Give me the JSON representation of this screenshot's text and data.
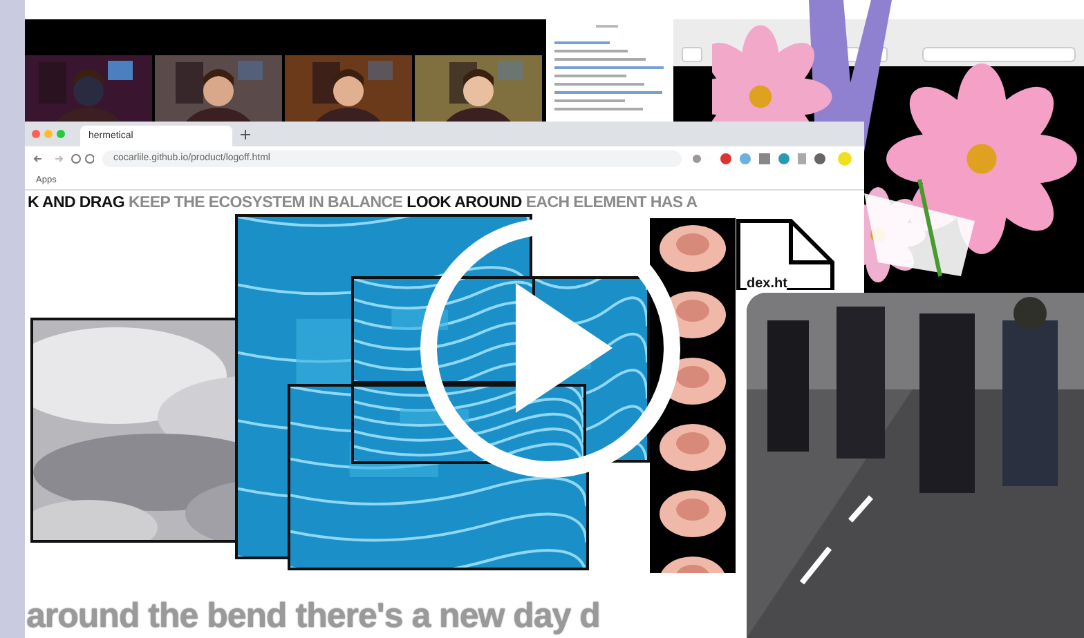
{
  "browser": {
    "tab_title": "hermetical",
    "url": "cocarlile.github.io/product/logoff.html",
    "bookmark": "Apps"
  },
  "marquee": [
    {
      "text": "K AND DRAG",
      "kind": "solid"
    },
    {
      "text": "KEEP THE ECOSYSTEM IN BALANCE",
      "kind": "outline"
    },
    {
      "text": "LOOK AROUND",
      "kind": "solid"
    },
    {
      "text": "EACH ELEMENT HAS A",
      "kind": "outline"
    }
  ],
  "file_icon": {
    "label": "dex.ht"
  },
  "caption": "around the bend there's a new day d"
}
